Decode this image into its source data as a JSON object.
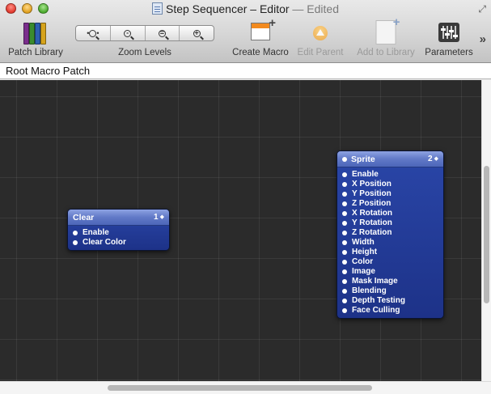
{
  "window": {
    "title": "Step Sequencer – Editor",
    "status": " — Edited"
  },
  "toolbar": {
    "patch_library": "Patch Library",
    "zoom_levels": "Zoom Levels",
    "zoom_buttons": [
      "fit",
      "-",
      "=",
      "+"
    ],
    "create_macro": "Create Macro",
    "edit_parent": "Edit Parent",
    "add_to_library": "Add to Library",
    "parameters": "Parameters"
  },
  "pathbar": {
    "label": "Root Macro Patch"
  },
  "patches": {
    "clear": {
      "title": "Clear",
      "count": "1",
      "ports": [
        "Enable",
        "Clear Color"
      ]
    },
    "sprite": {
      "title": "Sprite",
      "count": "2",
      "ports": [
        "Enable",
        "X Position",
        "Y Position",
        "Z Position",
        "X Rotation",
        "Y Rotation",
        "Z Rotation",
        "Width",
        "Height",
        "Color",
        "Image",
        "Mask Image",
        "Blending",
        "Depth Testing",
        "Face Culling"
      ]
    }
  },
  "colors": {
    "canvas": "#2b2b2b",
    "patch_body": "#1d3288",
    "patch_header": "#6179c7"
  }
}
